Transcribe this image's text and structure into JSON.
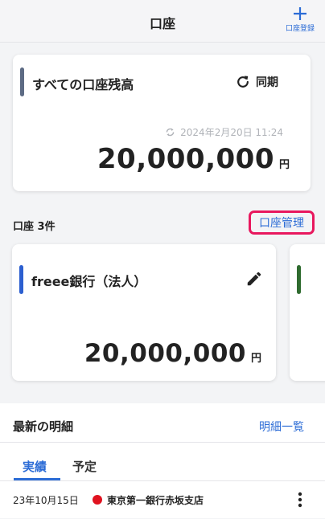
{
  "header": {
    "title": "口座",
    "add_label": "口座登録"
  },
  "total": {
    "title": "すべての口座残高",
    "sync_label": "同期",
    "timestamp": "2024年2月20日 11:24",
    "amount": "20,000,000",
    "currency": "円"
  },
  "accounts": {
    "count_label": "口座 3件",
    "manage_label": "口座管理",
    "cards": [
      {
        "name": "freee銀行（法人）",
        "amount": "20,000,000",
        "currency": "円",
        "color": "#2c5fd0"
      },
      {
        "color": "#2f6b2f"
      }
    ]
  },
  "details": {
    "title": "最新の明細",
    "link": "明細一覧",
    "tabs": [
      "実績",
      "予定"
    ],
    "rows": [
      {
        "date": "23年10月15日",
        "bank": "東京第一銀行赤坂支店",
        "dot_color": "#e0121f"
      }
    ]
  },
  "colors": {
    "accent": "#2c6cd6",
    "highlight": "#e8185e"
  }
}
